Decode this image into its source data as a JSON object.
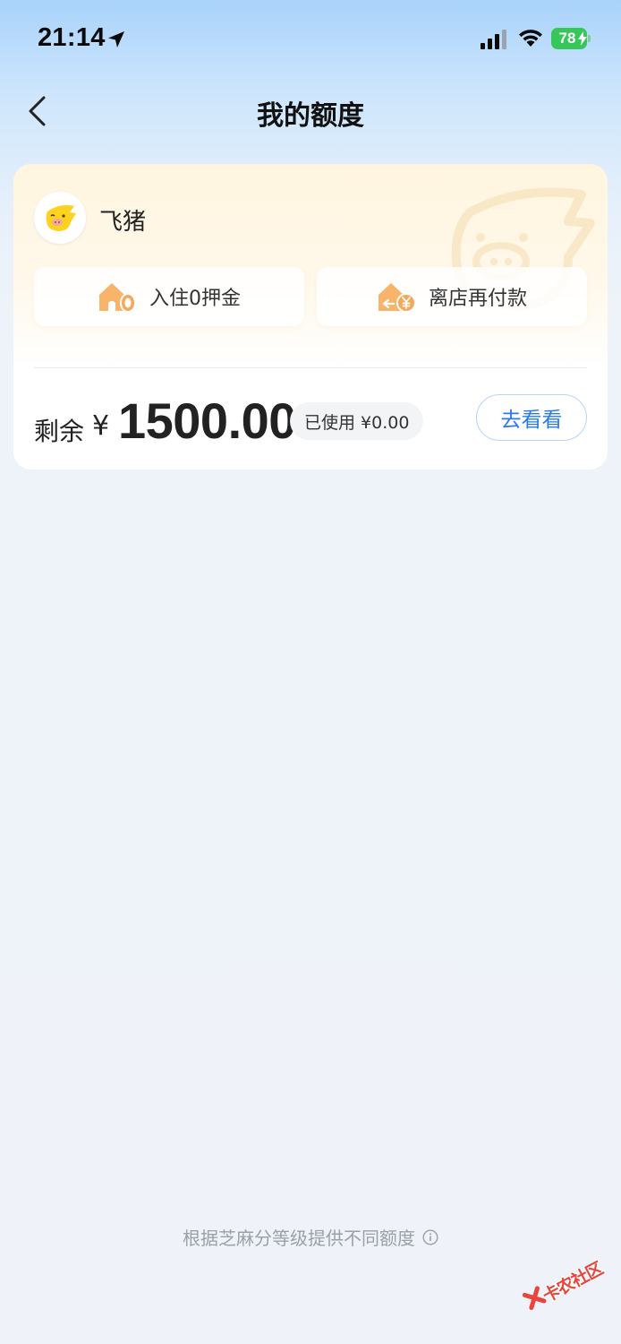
{
  "status_bar": {
    "time": "21:14",
    "battery": "78",
    "icons": [
      "location-arrow-icon",
      "cellular-signal-icon",
      "wifi-icon",
      "battery-charging-icon"
    ]
  },
  "nav": {
    "title": "我的额度",
    "back_icon": "chevron-left-icon"
  },
  "card": {
    "brand_name": "飞猪",
    "features": [
      {
        "label": "入住0押金",
        "icon": "house-zero-icon"
      },
      {
        "label": "离店再付款",
        "icon": "house-yuan-icon"
      }
    ],
    "remaining_label": "剩余",
    "currency_symbol": "¥",
    "remaining_amount": "1500.00",
    "used_text": "已使用 ¥0.00",
    "action_label": "去看看"
  },
  "footer": {
    "note": "根据芝麻分等级提供不同额度",
    "info_icon": "info-circle-icon"
  },
  "watermark": {
    "text": "卡农社区"
  },
  "colors": {
    "accent": "#2a7ae8",
    "feature_icon": "#f5a85a",
    "card_gradient_top": "#fff5df",
    "background": "#eff3f9"
  }
}
